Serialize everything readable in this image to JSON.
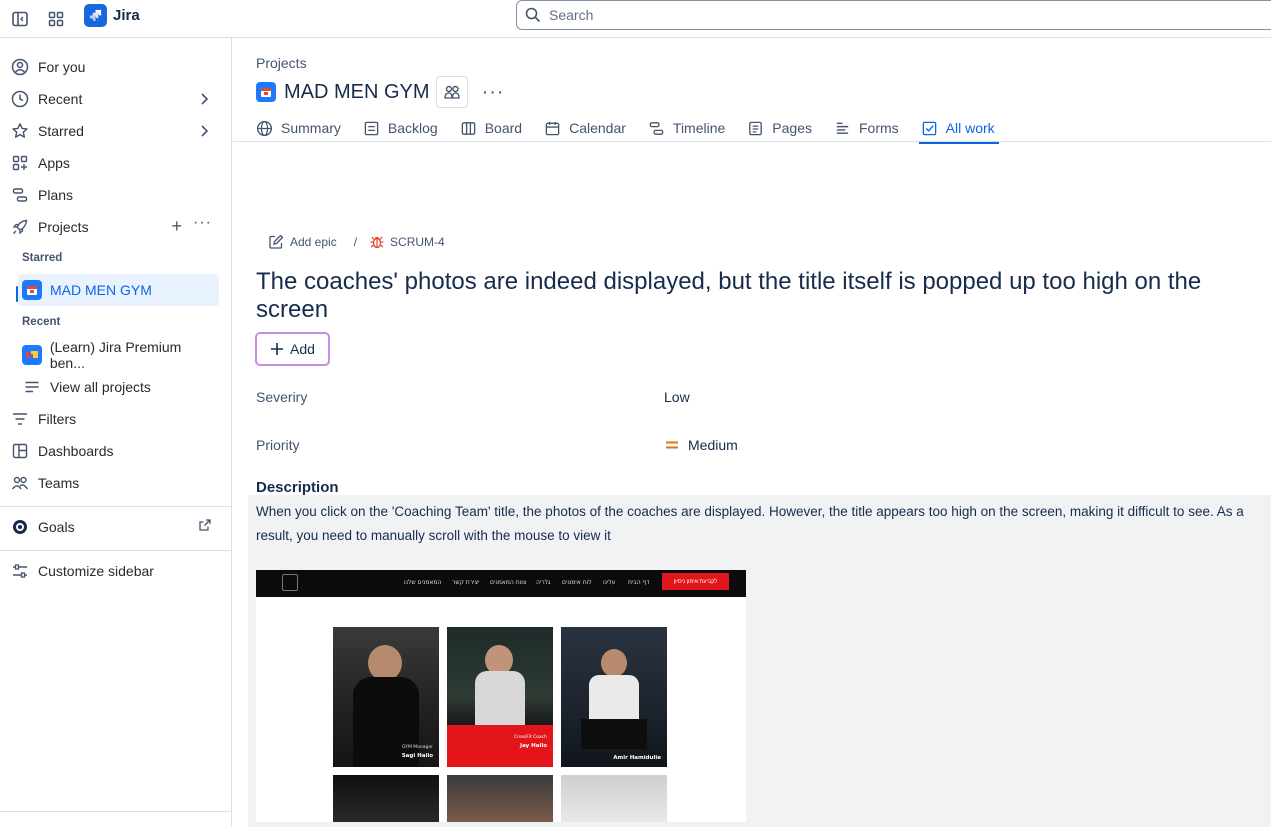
{
  "topbar": {
    "app_name": "Jira",
    "search_placeholder": "Search"
  },
  "sidebar": {
    "items": [
      {
        "label": "For you",
        "icon": "user-circle-icon"
      },
      {
        "label": "Recent",
        "icon": "clock-icon"
      },
      {
        "label": "Starred",
        "icon": "star-icon"
      },
      {
        "label": "Apps",
        "icon": "apps-icon"
      },
      {
        "label": "Plans",
        "icon": "plans-icon"
      },
      {
        "label": "Projects",
        "icon": "rocket-icon"
      }
    ],
    "starred_heading": "Starred",
    "starred_project": "MAD MEN GYM",
    "recent_heading": "Recent",
    "recent_project": "(Learn) Jira Premium ben...",
    "view_all": "View all projects",
    "lower_items": [
      {
        "label": "Filters",
        "icon": "filter-icon"
      },
      {
        "label": "Dashboards",
        "icon": "dashboard-icon"
      },
      {
        "label": "Teams",
        "icon": "teams-icon"
      }
    ],
    "goals": "Goals",
    "customize": "Customize sidebar"
  },
  "project": {
    "breadcrumb": "Projects",
    "name": "MAD MEN GYM",
    "tabs": [
      {
        "label": "Summary",
        "icon": "globe-icon"
      },
      {
        "label": "Backlog",
        "icon": "backlog-icon"
      },
      {
        "label": "Board",
        "icon": "board-icon"
      },
      {
        "label": "Calendar",
        "icon": "calendar-icon"
      },
      {
        "label": "Timeline",
        "icon": "timeline-icon"
      },
      {
        "label": "Pages",
        "icon": "pages-icon"
      },
      {
        "label": "Forms",
        "icon": "forms-icon"
      },
      {
        "label": "All work",
        "icon": "all-work-icon"
      }
    ],
    "active_tab": "All work"
  },
  "issue": {
    "add_epic": "Add epic",
    "separator": "/",
    "key": "SCRUM-4",
    "title": "The coaches' photos are indeed displayed, but the title itself is popped up too high on the screen",
    "add_button": "Add",
    "fields": [
      {
        "label": "Severiry",
        "value": "Low"
      },
      {
        "label": "Priority",
        "value": "Medium"
      }
    ],
    "description_heading": "Description",
    "description_text": "When you click on the 'Coaching Team' title, the photos of the coaches are displayed. However, the title appears too high on the screen, making it difficult to see. As a result, you need to manually scroll with the mouse to view it"
  },
  "attachment": {
    "cta": "לקביעת אימון ניסיון",
    "nav": [
      "דף הבית",
      "עלינו",
      "לוח אימונים",
      "גלריה",
      "צוות המאמנים",
      "יצירת קשר",
      "המאמנים שלנו"
    ],
    "coaches": [
      {
        "name": "Sagi Hailo",
        "role": "GYM Manager"
      },
      {
        "name": "Jay Hailo",
        "role": "CrossFit Coach"
      },
      {
        "name": "Amir Hamidulie",
        "role": ""
      }
    ]
  },
  "colors": {
    "accent": "#0c66e4",
    "priority_medium": "#e2740f",
    "bug": "#e34935"
  }
}
